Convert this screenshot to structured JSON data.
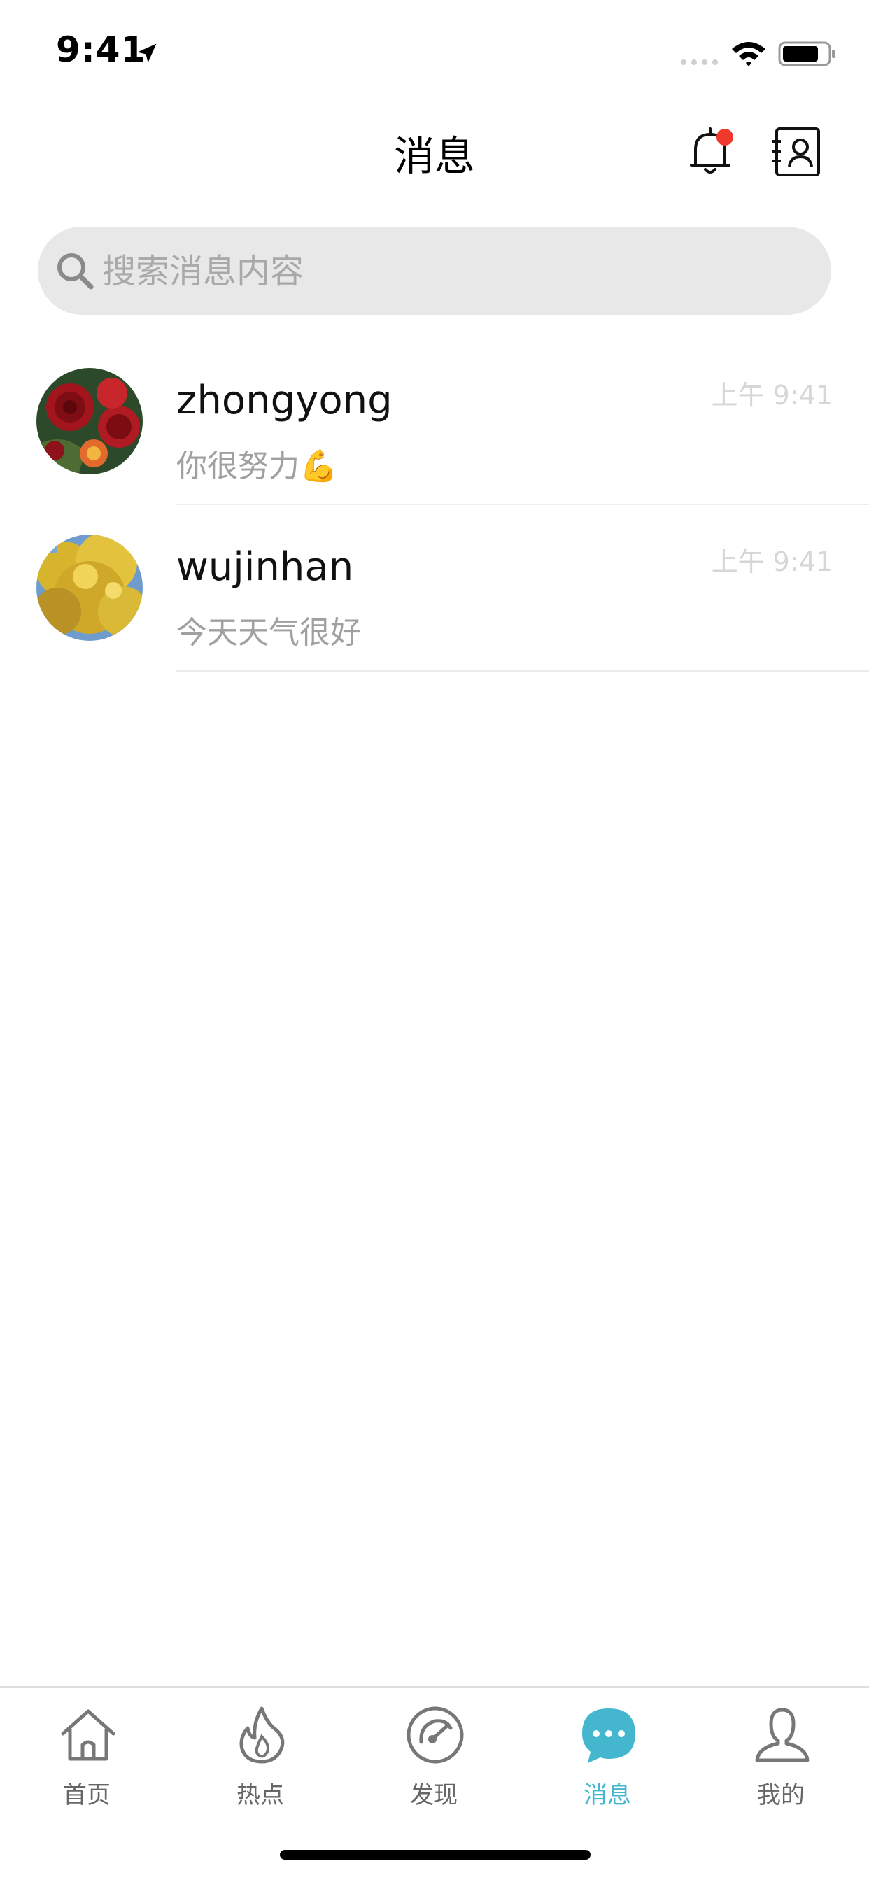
{
  "status_bar": {
    "time": "9:41"
  },
  "header": {
    "title": "消息",
    "notification_dot_color": "#f0382d"
  },
  "search": {
    "placeholder": "搜索消息内容"
  },
  "conversations": [
    {
      "name": "zhongyong",
      "time": "上午 9:41",
      "message": "你很努力💪",
      "avatar": "rose-flowers-avatar"
    },
    {
      "name": "wujinhan",
      "time": "上午 9:41",
      "message": "今天天气很好",
      "avatar": "ginkgo-tree-avatar"
    }
  ],
  "tab_bar": {
    "active_color": "#44b7cf",
    "items": [
      {
        "label": "首页",
        "icon": "home-icon"
      },
      {
        "label": "热点",
        "icon": "flame-icon"
      },
      {
        "label": "发现",
        "icon": "compass-icon"
      },
      {
        "label": "消息",
        "icon": "chat-bubble-icon",
        "active": true
      },
      {
        "label": "我的",
        "icon": "person-icon"
      }
    ]
  }
}
